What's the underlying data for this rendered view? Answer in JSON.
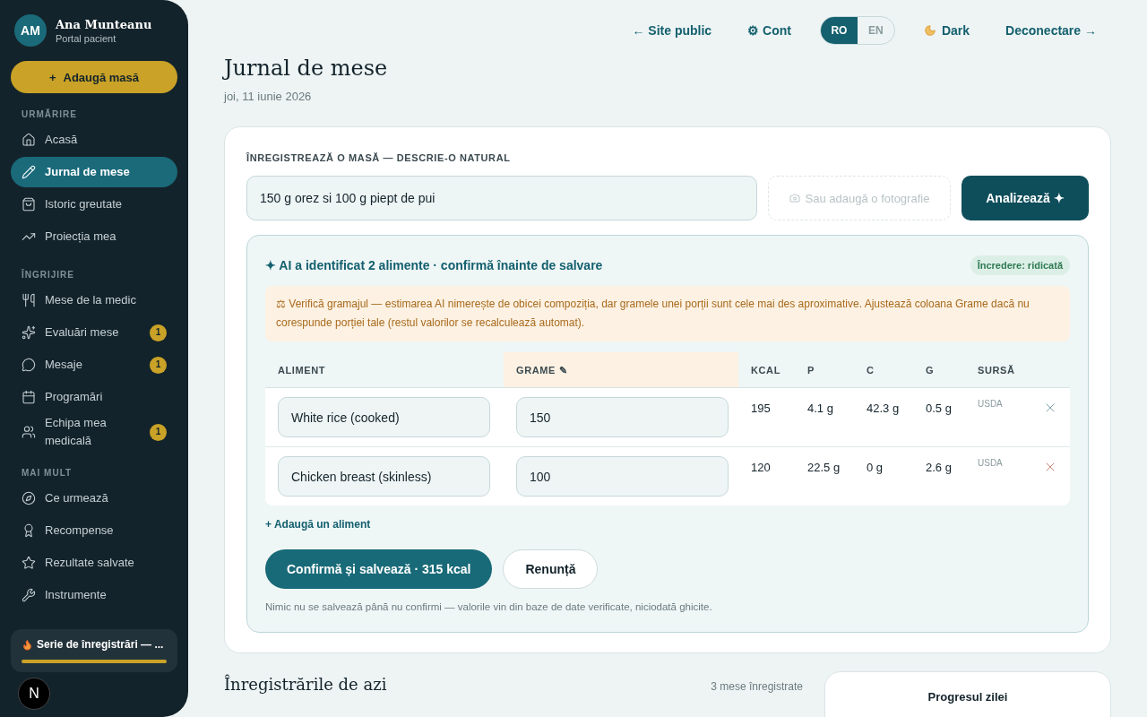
{
  "user": {
    "initials": "AM",
    "name": "Ana Munteanu",
    "role": "Portal pacient"
  },
  "add_meal_button": {
    "icon": "+",
    "label": "Adaugă masă"
  },
  "sidebar": {
    "sections": [
      {
        "title": "URMĂRIRE",
        "items": [
          {
            "label": "Acasă",
            "selected": false
          },
          {
            "label": "Jurnal de mese",
            "selected": true
          },
          {
            "label": "Istoric greutate",
            "selected": false
          },
          {
            "label": "Proiecția mea",
            "selected": false
          }
        ]
      },
      {
        "title": "ÎNGRIJIRE",
        "items": [
          {
            "label": "Mese de la medic",
            "selected": false
          },
          {
            "label": "Evaluări mese",
            "selected": false,
            "badge": "1"
          },
          {
            "label": "Mesaje",
            "selected": false,
            "badge": "1"
          },
          {
            "label": "Programări",
            "selected": false
          },
          {
            "label": "Echipa mea medicală",
            "selected": false,
            "badge": "1"
          }
        ]
      },
      {
        "title": "MAI MULT",
        "items": [
          {
            "label": "Ce urmează",
            "selected": false
          },
          {
            "label": "Recompense",
            "selected": false
          },
          {
            "label": "Rezultate salvate",
            "selected": false
          },
          {
            "label": "Instrumente",
            "selected": false
          }
        ]
      }
    ]
  },
  "streak": {
    "label": "Serie de înregistrări — ...",
    "level": 1
  },
  "fab": {
    "label": "N"
  },
  "top_nav": {
    "links": [
      "← Site public",
      "⚙ Cont",
      "Dark",
      "Deconectare →"
    ],
    "languages": [
      {
        "label": "RO",
        "selected": true
      },
      {
        "label": "EN",
        "selected": false
      }
    ]
  },
  "page": {
    "title": "Jurnal de mese",
    "date": "joi, 11 iunie 2026"
  },
  "log_card": {
    "label": "ÎNREGISTREAZĂ O MASĂ — DESCRIE-O NATURAL",
    "input_value": "150 g orez si 100 g piept de pui",
    "photo_placeholder": "Sau adaugă o fotografie",
    "analyze_button": "Analizează ✦"
  },
  "ai_panel": {
    "title": "✦ AI a identificat 2 alimente · confirmă înainte de salvare",
    "confidence": "Încredere: ridicată",
    "warning": "⚖ Verifică gramajul — estimarea AI nimerește de obicei compoziția, dar gramele unei porții sunt cele mai des aproximative. Ajustează coloana Grame dacă nu corespunde porției tale (restul valorilor se recalculează automat).",
    "columns": [
      "ALIMENT",
      "GRAME ✎",
      "KCAL",
      "P",
      "C",
      "G",
      "SURSĂ"
    ],
    "rows": [
      {
        "food": "White rice (cooked)",
        "grams": "150",
        "kcal": "195",
        "p": "4.1 g",
        "c": "42.3 g",
        "g": "0.5 g",
        "source": "USDA"
      },
      {
        "food": "Chicken breast (skinless)",
        "grams": "100",
        "kcal": "120",
        "p": "22.5 g",
        "c": "0 g",
        "g": "2.6 g",
        "source": "USDA"
      }
    ],
    "add_food_link": "+ Adaugă un aliment",
    "confirm_button": "Confirmă și salvează · 315 kcal",
    "cancel_button": "Renunță",
    "note": "Nimic nu se salvează până nu confirmi — valorile vin din baze de date verificate, niciodată ghicite."
  },
  "today": {
    "title": "Înregistrările de azi",
    "count": "3 mese înregistrate"
  },
  "progress_card": {
    "title": "Progresul zilei"
  }
}
